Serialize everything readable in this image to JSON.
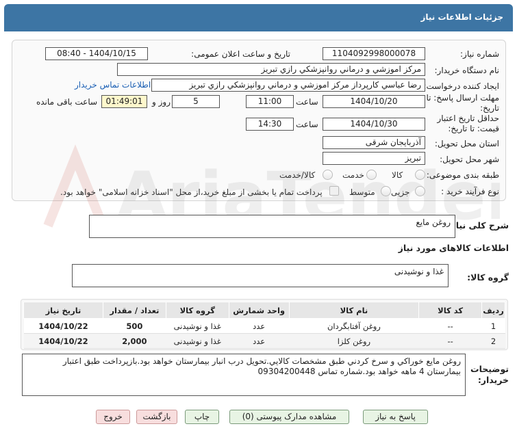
{
  "header": {
    "title": "جزئیات اطلاعات نیاز"
  },
  "form": {
    "need_number_label": "شماره نیاز:",
    "need_number": "1104092998000078",
    "announce_label": "تاریخ و ساعت اعلان عمومی:",
    "announce_value": "1404/10/15 - 08:40",
    "buyer_label": "نام دستگاه خریدار:",
    "buyer_value": "مرکز اموزشي و درماني روانپزشکي رازي تبريز",
    "creator_label": "ایجاد کننده درخواست:",
    "creator_value": "رضا عباسي کارپرداز مرکز اموزشي و درماني روانپزشکي رازي تبريز",
    "contact_link": "اطلاعات تماس خریدار",
    "reply_deadline_label": "مهلت ارسال پاسخ: تا تاریخ:",
    "reply_date": "1404/10/20",
    "time_word": "ساعت",
    "reply_time": "11:00",
    "days_value": "5",
    "days_word": "روز و",
    "remaining_time": "01:49:01",
    "remaining_word": "ساعت باقی مانده",
    "price_validity_label": "حداقل تاریخ اعتبار قیمت: تا تاریخ:",
    "price_date": "1404/10/30",
    "price_time": "14:30",
    "province_label": "استان محل تحویل:",
    "province_value": "آذربایجان شرقی",
    "city_label": "شهر محل تحویل:",
    "city_value": "تبریز",
    "category_label": "طبقه بندی موضوعی:",
    "category_options": [
      "کالا",
      "خدمت",
      "کالا/خدمت"
    ],
    "purchase_type_label": "نوع فرآیند خرید :",
    "purchase_options": [
      "جزیی",
      "متوسط"
    ],
    "payment_note": "پرداخت تمام یا بخشی از مبلغ خرید،از محل \"اسناد خزانه اسلامی\" خواهد بود."
  },
  "description": {
    "label": "شرح کلی نیاز:",
    "value": "روغن مایع"
  },
  "goods": {
    "section_title": "اطلاعات کالاهای مورد نیاز",
    "group_label": "گروه کالا:",
    "group_value": "غذا و نوشیدنی",
    "columns": [
      "ردیف",
      "کد کالا",
      "نام کالا",
      "واحد شمارش",
      "گروه کالا",
      "تعداد / مقدار",
      "تاریخ نیاز"
    ],
    "rows": [
      {
        "row": "1",
        "code": "--",
        "name": "روغن آفتابگردان",
        "unit": "عدد",
        "group": "غذا و نوشیدنی",
        "qty": "500",
        "date": "1404/10/22"
      },
      {
        "row": "2",
        "code": "--",
        "name": "روغن کلزا",
        "unit": "عدد",
        "group": "غذا و نوشیدنی",
        "qty": "2,000",
        "date": "1404/10/22"
      }
    ]
  },
  "notes": {
    "label": "توضیحات خریدار:",
    "value": "روغن مايع خوراکي و سرخ کردني طبق مشخصات کالايي.تحويل درب انبار بيمارستان خواهد بود.بازپرداخت طبق اعتبار بيمارستان 4 ماهه خواهد بود.شماره تماس 09304200448"
  },
  "buttons": {
    "reply": "پاسخ به نیاز",
    "attachments": "مشاهده مدارک پیوستی (0)",
    "print": "چاپ",
    "back": "بازگشت",
    "exit": "خروج"
  },
  "watermark": {
    "text": "AriaTender.neT"
  },
  "colors": {
    "header": "#3d75a4",
    "link": "#1a5fb4",
    "remaining_bg": "#fff8cc"
  }
}
